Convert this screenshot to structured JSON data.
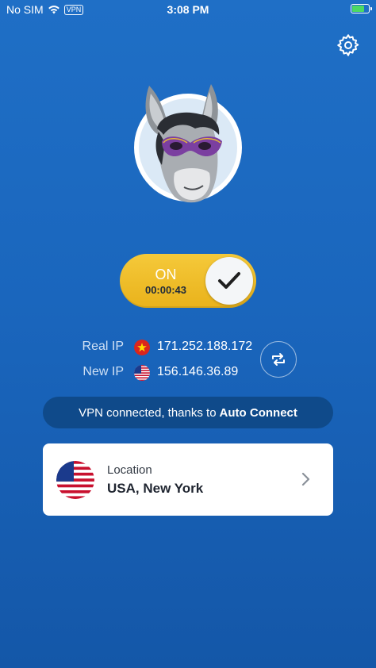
{
  "status_bar": {
    "carrier": "No SIM",
    "vpn_badge": "VPN",
    "time": "3:08 PM",
    "battery_level": 0.7
  },
  "header": {
    "settings_icon": "gear-icon"
  },
  "avatar": {
    "icon": "donkey-mascot-icon"
  },
  "toggle": {
    "state_label": "ON",
    "timer": "00:00:43",
    "is_on": true,
    "accent": "#f2c12e"
  },
  "ip_info": {
    "real_ip_label": "Real IP",
    "real_ip_value": "171.252.188.172",
    "real_ip_flag": "vietnam-flag-icon",
    "new_ip_label": "New IP",
    "new_ip_value": "156.146.36.89",
    "new_ip_flag": "usa-flag-icon",
    "swap_icon": "refresh-icon"
  },
  "status_message": {
    "text": "VPN connected, thanks to",
    "highlight": "Auto Connect"
  },
  "location": {
    "label": "Location",
    "value": "USA, New York",
    "flag": "usa-flag-icon",
    "chevron": "chevron-right-icon"
  }
}
